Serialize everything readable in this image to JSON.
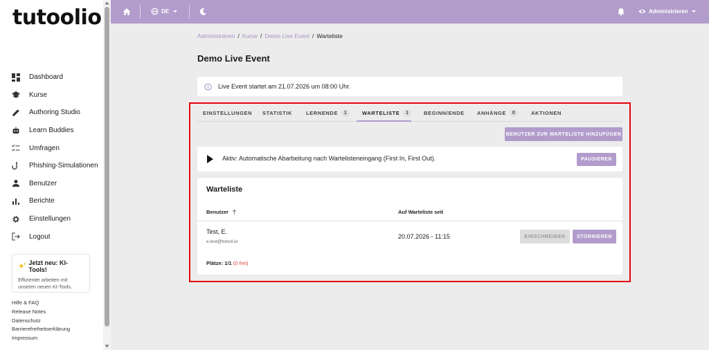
{
  "brand": {
    "logo_text": "tutoolio"
  },
  "sidebar": {
    "items": [
      {
        "label": "Dashboard",
        "icon": "dashboard-icon"
      },
      {
        "label": "Kurse",
        "icon": "graduation-cap-icon"
      },
      {
        "label": "Authoring Studio",
        "icon": "pencil-icon"
      },
      {
        "label": "Learn Buddies",
        "icon": "robot-icon"
      },
      {
        "label": "Umfragen",
        "icon": "checklist-icon"
      },
      {
        "label": "Phishing-Simulationen",
        "icon": "hook-icon"
      },
      {
        "label": "Benutzer",
        "icon": "person-icon"
      },
      {
        "label": "Berichte",
        "icon": "bar-chart-icon"
      },
      {
        "label": "Einstellungen",
        "icon": "gear-icon"
      },
      {
        "label": "Logout",
        "icon": "logout-icon"
      }
    ],
    "ki_card": {
      "title": "Jetzt neu: KI-Tools!",
      "text": "Effizienter arbeiten mit unseren neuen KI-Tools."
    },
    "footer_links": [
      "Hilfe & FAQ",
      "Release Notes",
      "Datenschutz",
      "Barrierefreiheitserklärung",
      "Impressum"
    ]
  },
  "topbar": {
    "language": "DE",
    "role": "Administrieren",
    "colors": {
      "bar": "#b19ccc"
    }
  },
  "breadcrumb": {
    "items": [
      "Administrieren",
      "Kurse",
      "Demo Live Event"
    ],
    "current": "Warteliste",
    "separator": "/"
  },
  "page": {
    "title": "Demo Live Event",
    "info": "Live Event startet am 21.07.2026 um 08:00 Uhr."
  },
  "tabs": [
    {
      "label": "EINSTELLUNGEN",
      "count": null
    },
    {
      "label": "STATISTIK",
      "count": null
    },
    {
      "label": "LERNENDE",
      "count": "1"
    },
    {
      "label": "WARTELISTE",
      "count": "1",
      "active": true
    },
    {
      "label": "BEGINN/ENDE",
      "count": null
    },
    {
      "label": "ANHÄNGE",
      "count": "0"
    },
    {
      "label": "AKTIONEN",
      "count": null
    }
  ],
  "waitlist": {
    "add_button": "BENUTZER ZUR WARTELISTE HINZUFÜGEN",
    "auto_text": "Aktiv: Automatische Abarbeitung nach Wartelisteneingang (First In, First Out).",
    "pause_button": "PAUSIEREN",
    "card_title": "Warteliste",
    "columns": {
      "user": "Benutzer",
      "since": "Auf Warteliste seit"
    },
    "rows": [
      {
        "name": "Test, E.",
        "email": "e.test@tutool.io",
        "since": "20.07.2026 - 11:15",
        "enroll_button": "EINSCHREIBEN",
        "cancel_button": "STORNIEREN"
      }
    ],
    "places_label": "Plätze:",
    "places_value": "1/1",
    "places_free": "(0 frei)"
  }
}
